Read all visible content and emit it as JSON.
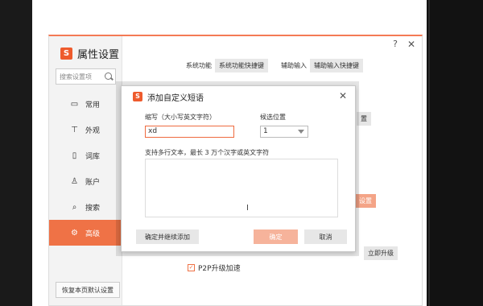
{
  "settings": {
    "title": "属性设置",
    "logo_letter": "S",
    "search_placeholder": "搜索设置项",
    "nav": [
      {
        "label": "常用",
        "icon": "monitor-icon"
      },
      {
        "label": "外观",
        "icon": "shirt-icon"
      },
      {
        "label": "词库",
        "icon": "book-icon"
      },
      {
        "label": "账户",
        "icon": "user-icon"
      },
      {
        "label": "搜索",
        "icon": "search-icon"
      },
      {
        "label": "高级",
        "icon": "gear-icon",
        "active": true
      }
    ],
    "restore_label": "恢复本页默认设置",
    "top_help": "?",
    "top_close": "✕",
    "content": {
      "system_label": "系统功能",
      "system_chip": "系统功能快捷键",
      "assist_label": "辅助输入",
      "assist_chip": "辅助输入快捷键",
      "chip_partial_1": "置",
      "chip_partial_2": "设置",
      "upgrade_chip": "立即升级",
      "p2p_label": "P2P升级加速",
      "p2p_checked": true
    }
  },
  "dialog": {
    "title": "添加自定义短语",
    "logo_letter": "S",
    "close": "✕",
    "abbr_label": "缩写（大小写英文字符）",
    "abbr_value": "xd",
    "position_label": "候选位置",
    "position_value": "1",
    "textarea_hint": "支持多行文本，最长 3 万个汉字或英文字符",
    "textarea_value": "",
    "btn_continue": "确定并继续添加",
    "btn_ok": "确定",
    "btn_cancel": "取消"
  },
  "colors": {
    "accent": "#ef7246",
    "accent_light": "#f6b39b"
  }
}
